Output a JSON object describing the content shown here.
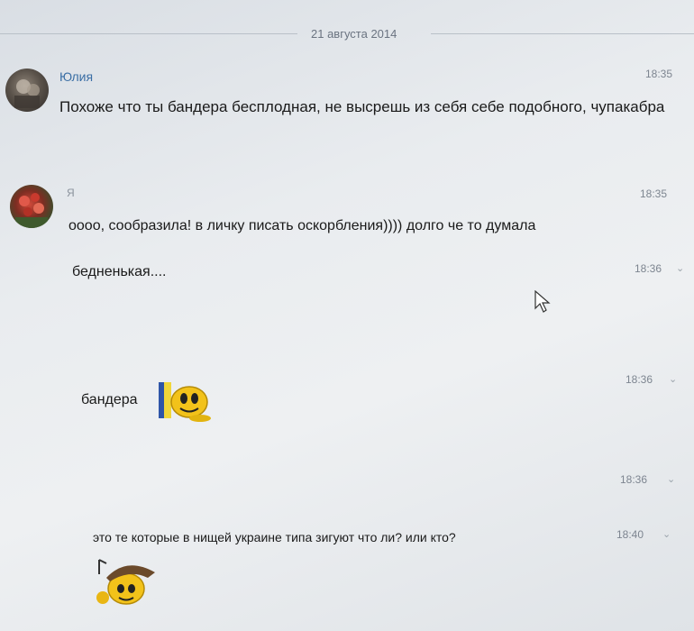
{
  "chat": {
    "date": "21 августа 2014",
    "messages": [
      {
        "sender": "Юлия",
        "time": "18:35",
        "text": "Похоже что ты бандера бесплодная, не высрешь из себя себе подобного, чупакабра"
      },
      {
        "sender": "Я",
        "time": "18:35",
        "text": "оооо, сообразила! в личку писать оскорбления)))) долго че то думала"
      },
      {
        "time": "18:36",
        "text": "бедненькая...."
      },
      {
        "time": "18:36",
        "text": "бандера",
        "sticker": "smiley-flag-sticker"
      },
      {
        "time": "18:36",
        "text": ""
      },
      {
        "time": "18:40",
        "text": "это те которые в нищей украине типа зигуют что ли? или кто?",
        "sticker": "smiley-cap-sticker"
      }
    ]
  },
  "colors": {
    "name_link": "#3a6ea5",
    "timestamp": "#7d8590",
    "divider": "#b9c0c8"
  }
}
